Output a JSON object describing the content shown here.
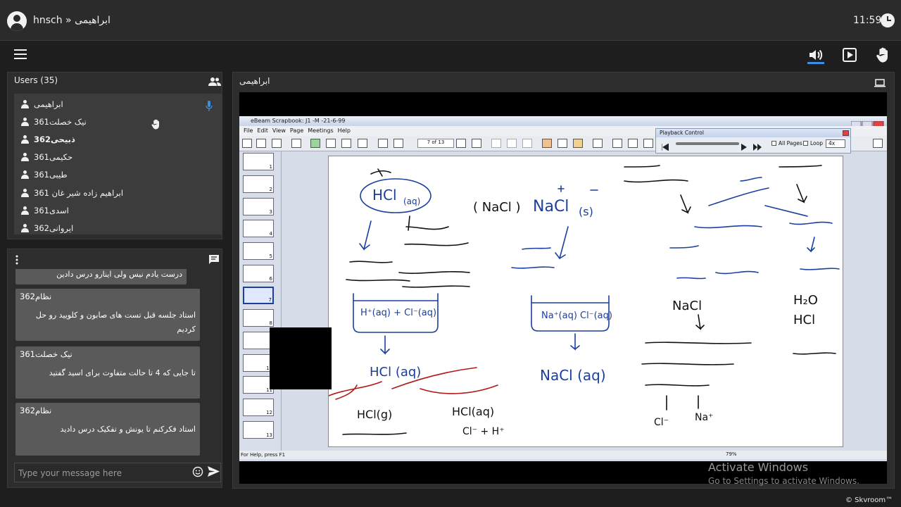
{
  "topbar": {
    "breadcrumb": "hnsch » ابراهیمی",
    "clock": "11:59"
  },
  "toolbar_icons": [
    "menu-icon",
    "volume-icon",
    "play-box-icon",
    "raise-hand-icon"
  ],
  "users": {
    "title": "Users (35)",
    "items": [
      {
        "name": "ابراهیمی"
      },
      {
        "name": "نیک خصلت361"
      },
      {
        "name": "ذبیحی362"
      },
      {
        "name": "حکیمی361"
      },
      {
        "name": "طیبی361"
      },
      {
        "name": "ابراهیم زاده شیر غان 361"
      },
      {
        "name": "اسدی361"
      },
      {
        "name": "ایروانی362"
      }
    ]
  },
  "chat": {
    "messages": [
      {
        "author": "",
        "text": "درست یادم نیس ولی اینارو درس دادین"
      },
      {
        "author": "نظام362",
        "text": "استاد جلسه قبل تست های صابون و کلویید رو حل کردیم"
      },
      {
        "author": "نیک خصلت361",
        "text": "تا جایی که 4 تا حالت متفاوت برای اسید گفتید"
      },
      {
        "author": "نظام362",
        "text": "استاد فکرکنم تا یونش و تفکیک درس دادید"
      }
    ],
    "input_placeholder": "Type your message here"
  },
  "presentation": {
    "title": "ابراهیمی",
    "app_title": "eBeam Scrapbook: J1 -M -21-6-99",
    "menu": [
      "File",
      "Edit",
      "View",
      "Page",
      "Meetings",
      "Help"
    ],
    "page_indicator": "7 of 13",
    "playback_title": "Playback Control",
    "playback_all_pages": "All Pages",
    "playback_loop": "Loop",
    "playback_speed": "4x",
    "status_text": "For Help, press F1",
    "zoom": "79%",
    "thumb_numbers": [
      "1",
      "2",
      "3",
      "4",
      "5",
      "6",
      "7",
      "8",
      "9",
      "10",
      "11",
      "12",
      "13"
    ]
  },
  "watermark": {
    "line1": "Activate Windows",
    "line2": "Go to Settings to activate Windows."
  },
  "brand": "© Skvroom™"
}
